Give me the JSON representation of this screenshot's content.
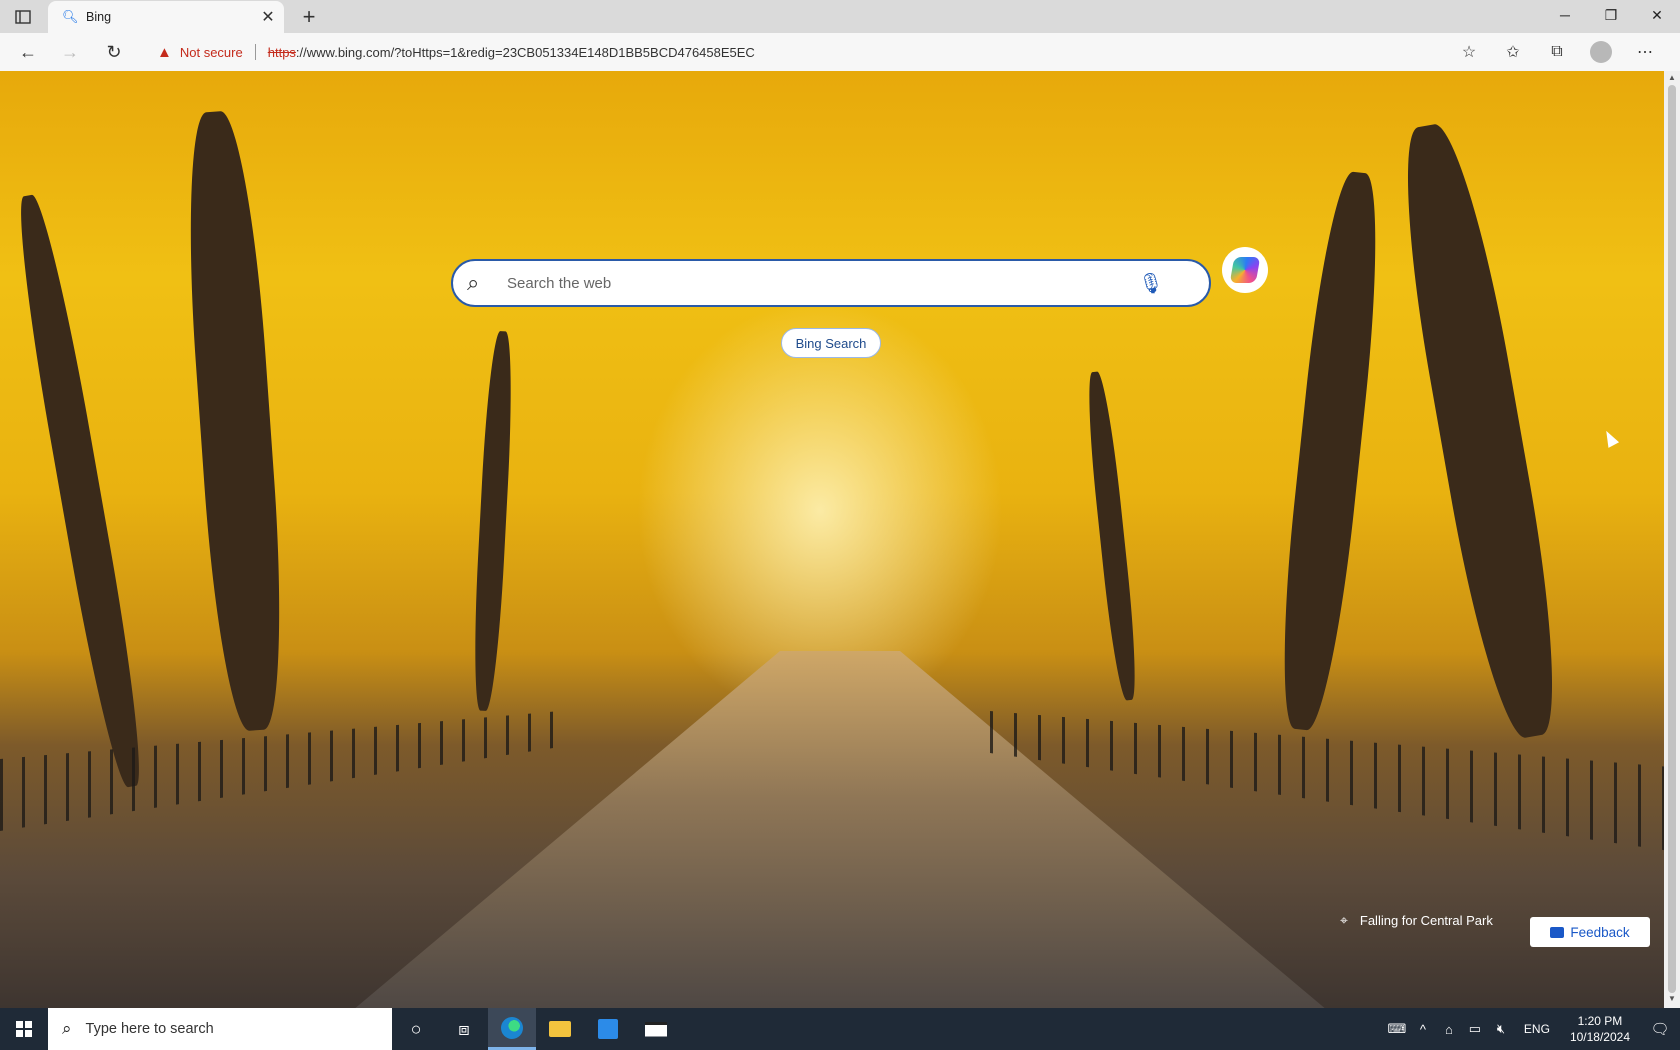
{
  "browser": {
    "tab_title": "Bing",
    "tab_favicon": "search-icon",
    "security_label": "Not secure",
    "url_scheme": "https",
    "url_rest": "://www.bing.com/?toHttps=1&redig=23CB051334E148D1BB5BCD476458E5EC"
  },
  "page": {
    "search_placeholder": "Search the web",
    "bing_search_label": "Bing Search",
    "image_caption": "Falling for Central Park",
    "feedback_label": "Feedback"
  },
  "taskbar": {
    "search_placeholder": "Type here to search",
    "language": "ENG",
    "time": "1:20 PM",
    "date": "10/18/2024"
  },
  "colors": {
    "accent": "#2a5aa8",
    "insecure": "#c42b1c",
    "taskbar_bg": "#1f2a37"
  }
}
